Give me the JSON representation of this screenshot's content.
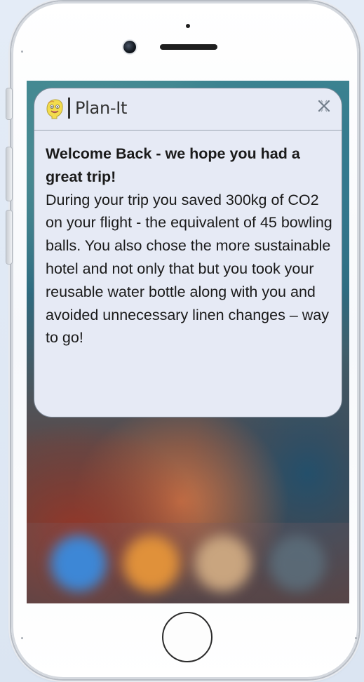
{
  "notification": {
    "app_name": "Plan-It",
    "title": "Welcome Back - we hope you had a great trip!",
    "message": "During your trip you saved 300kg of CO2 on your flight - the equivalent of 45 bowling balls. You also chose the more sustainable hotel and not only that but you took your reusable water bottle along with you and avoided unnecessary linen changes – way to go!",
    "icons": {
      "app": "smiley-emoji-icon",
      "close": "close-icon"
    }
  },
  "device": {
    "type": "smartphone",
    "home_button": "home-button"
  },
  "colors": {
    "card_background": "#e6eaf5",
    "card_border": "#7f8b99",
    "text": "#1a1a1a",
    "app_icon_yellow": "#f3dc4d"
  }
}
